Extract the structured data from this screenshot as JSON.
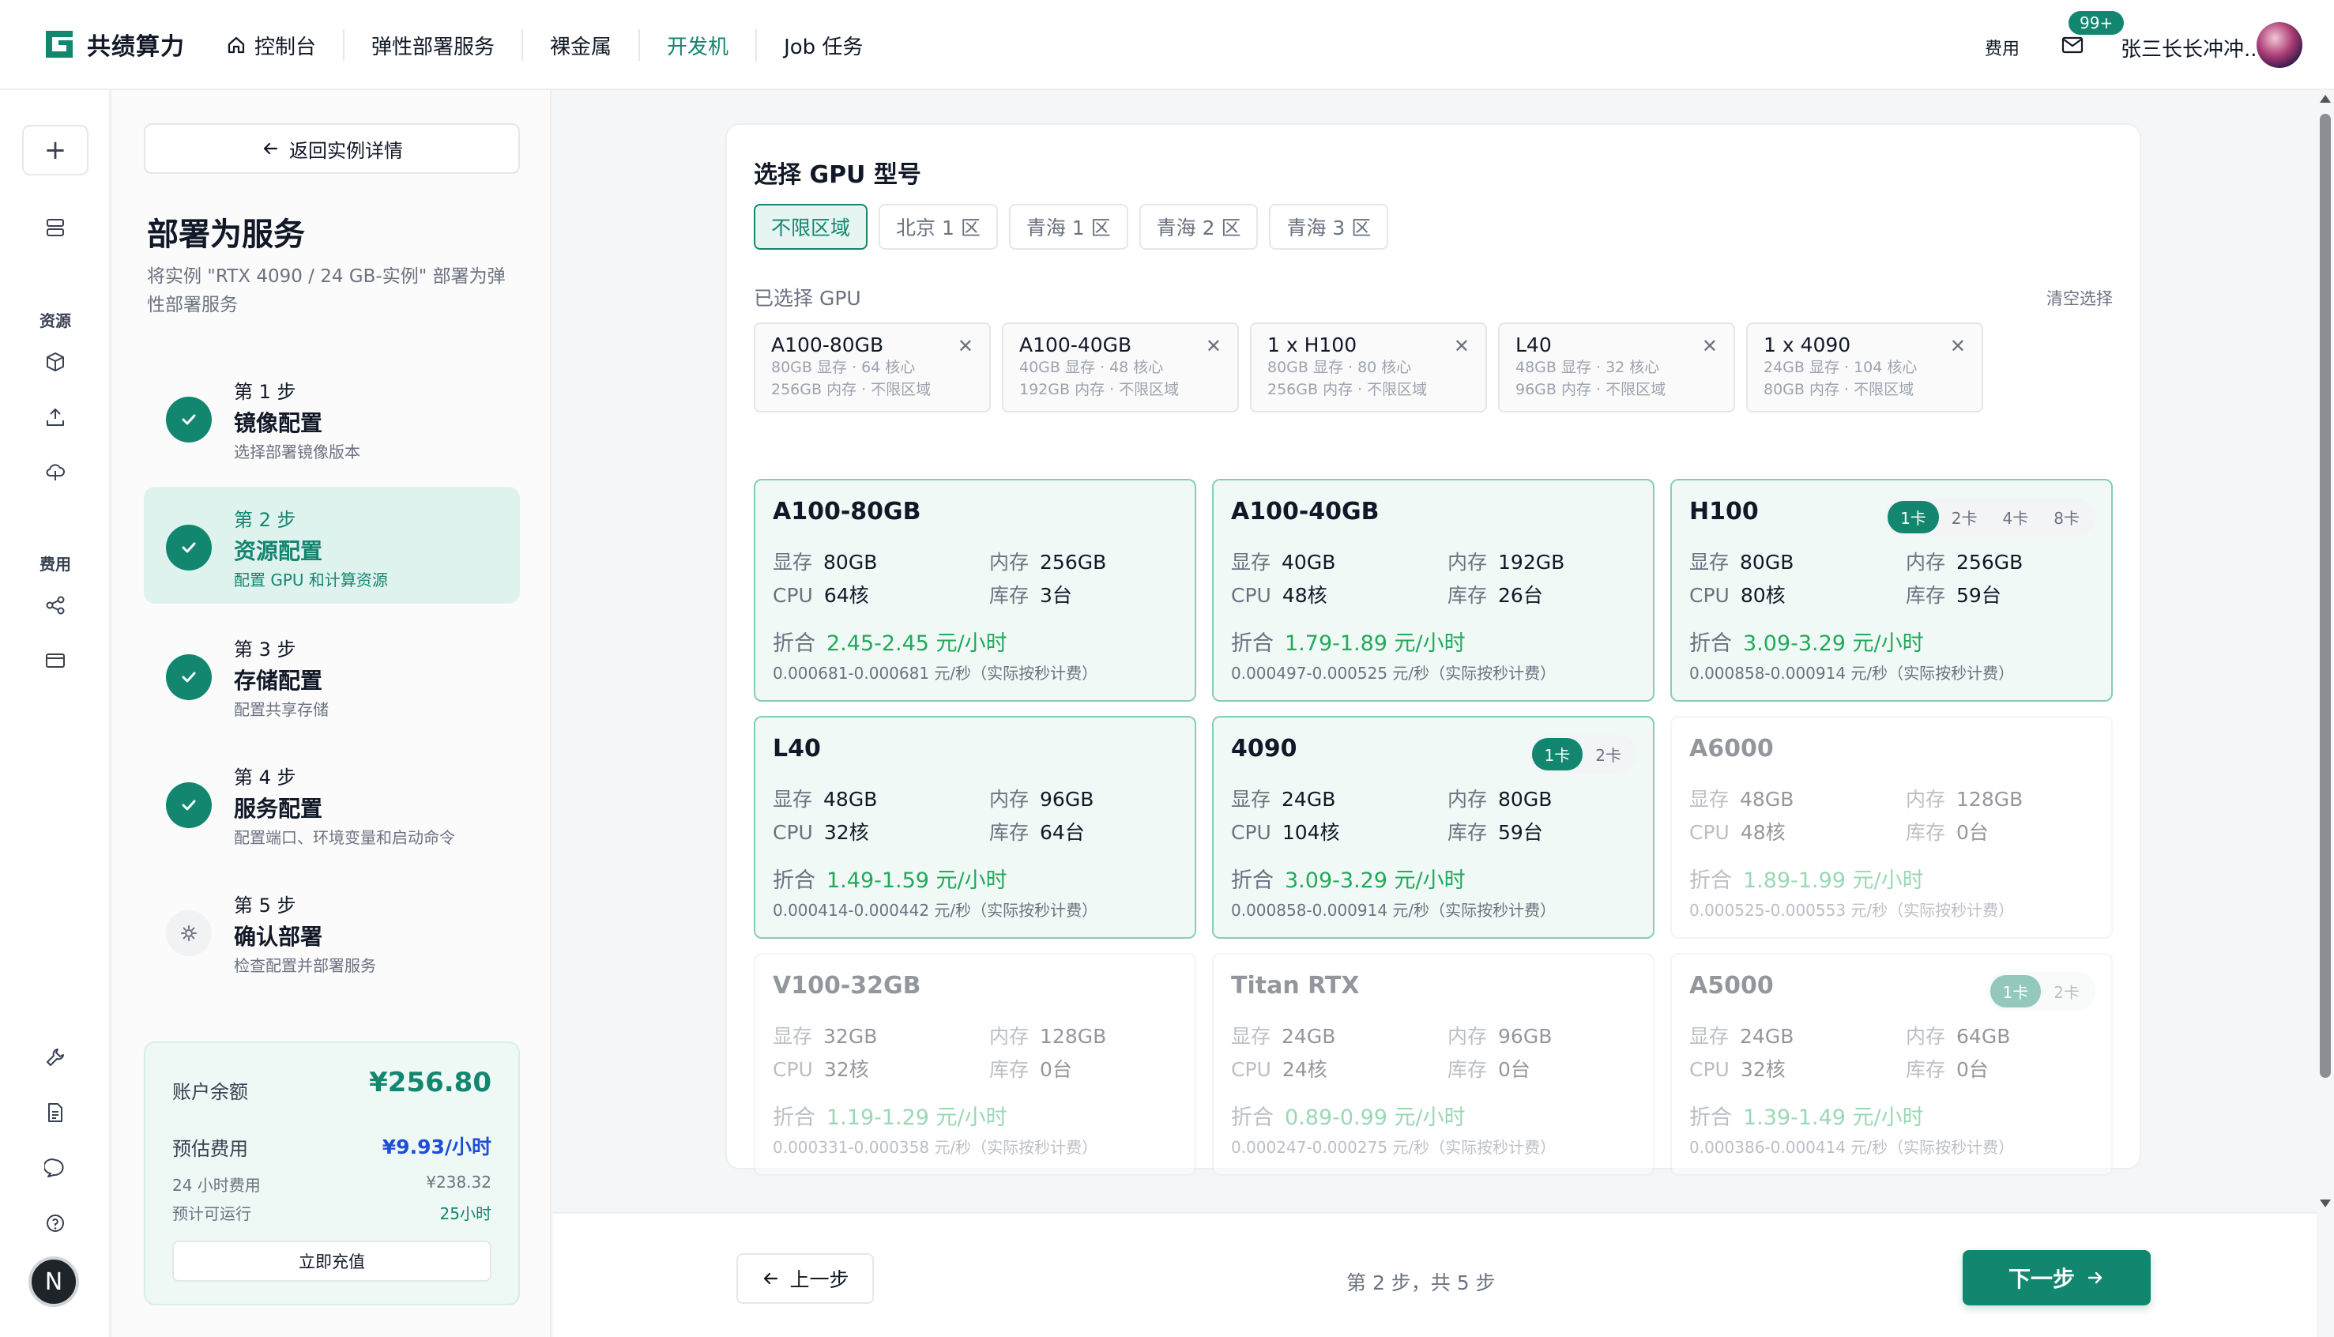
{
  "brand": {
    "name": "共绩算力",
    "accent": "#13866f"
  },
  "nav": [
    {
      "label": "控制台",
      "icon": "home-icon"
    },
    {
      "label": "弹性部署服务"
    },
    {
      "label": "裸金属"
    },
    {
      "label": "开发机",
      "active": true
    },
    {
      "label": "Job 任务"
    }
  ],
  "topright": {
    "fee": "费用",
    "badge": "99+",
    "username": "张三长长冲冲.."
  },
  "rail": {
    "section_resources": "资源",
    "section_fees": "费用",
    "user_initial": "N"
  },
  "steps_panel": {
    "back_label": "返回实例详情",
    "title": "部署为服务",
    "desc": "将实例 \"RTX 4090 / 24 GB-实例\" 部署为弹性部署服务",
    "steps": [
      {
        "num": "第 1 步",
        "name": "镜像配置",
        "sub": "选择部署镜像版本",
        "state": "done"
      },
      {
        "num": "第 2 步",
        "name": "资源配置",
        "sub": "配置 GPU 和计算资源",
        "state": "active"
      },
      {
        "num": "第 3 步",
        "name": "存储配置",
        "sub": "配置共享存储",
        "state": "done"
      },
      {
        "num": "第 4 步",
        "name": "服务配置",
        "sub": "配置端口、环境变量和启动命令",
        "state": "done"
      },
      {
        "num": "第 5 步",
        "name": "确认部署",
        "sub": "检查配置并部署服务",
        "state": "pending"
      }
    ],
    "balance": {
      "label": "账户余额",
      "value": "¥256.80",
      "est_label": "预估费用",
      "est_value": "¥9.93/小时",
      "day_label": "24 小时费用",
      "day_value": "¥238.32",
      "run_label": "预计可运行",
      "run_value": "25小时",
      "recharge": "立即充值"
    }
  },
  "gpu_select": {
    "title": "选择 GPU 型号",
    "regions": [
      "不限区域",
      "北京 1 区",
      "青海 1 区",
      "青海 2 区",
      "青海 3 区"
    ],
    "active_region": 0,
    "selected_label": "已选择 GPU",
    "clear_label": "清空选择",
    "chips": [
      {
        "name": "A100-80GB",
        "l1": "80GB 显存 · 64 核心",
        "l2": "256GB 内存 · 不限区域"
      },
      {
        "name": "A100-40GB",
        "l1": "40GB 显存 · 48 核心",
        "l2": "192GB 内存 · 不限区域"
      },
      {
        "name": "1 x H100",
        "l1": "80GB 显存 · 80 核心",
        "l2": "256GB 内存 · 不限区域"
      },
      {
        "name": "L40",
        "l1": "48GB 显存 · 32 核心",
        "l2": "96GB 内存 · 不限区域"
      },
      {
        "name": "1 x 4090",
        "l1": "24GB 显存 · 104 核心",
        "l2": "80GB 内存 · 不限区域"
      }
    ],
    "labels": {
      "vram": "显存",
      "mem": "内存",
      "cpu": "CPU",
      "stock": "库存",
      "price": "折合"
    },
    "cards": [
      {
        "name": "A100-80GB",
        "vram": "80GB",
        "mem": "256GB",
        "cpu": "64核",
        "stock": "3台",
        "price": "2.45-2.45 元/小时",
        "per_sec": "0.000681-0.000681 元/秒（实际按秒计费）",
        "state": "selected",
        "toggles": []
      },
      {
        "name": "A100-40GB",
        "vram": "40GB",
        "mem": "192GB",
        "cpu": "48核",
        "stock": "26台",
        "price": "1.79-1.89 元/小时",
        "per_sec": "0.000497-0.000525 元/秒（实际按秒计费）",
        "state": "selected",
        "toggles": []
      },
      {
        "name": "H100",
        "vram": "80GB",
        "mem": "256GB",
        "cpu": "80核",
        "stock": "59台",
        "price": "3.09-3.29 元/小时",
        "per_sec": "0.000858-0.000914 元/秒（实际按秒计费）",
        "state": "selected",
        "toggles": [
          "1卡",
          "2卡",
          "4卡",
          "8卡"
        ]
      },
      {
        "name": "L40",
        "vram": "48GB",
        "mem": "96GB",
        "cpu": "32核",
        "stock": "64台",
        "price": "1.49-1.59 元/小时",
        "per_sec": "0.000414-0.000442 元/秒（实际按秒计费）",
        "state": "selected",
        "toggles": []
      },
      {
        "name": "4090",
        "vram": "24GB",
        "mem": "80GB",
        "cpu": "104核",
        "stock": "59台",
        "price": "3.09-3.29 元/小时",
        "per_sec": "0.000858-0.000914 元/秒（实际按秒计费）",
        "state": "selected",
        "toggles": [
          "1卡",
          "2卡"
        ]
      },
      {
        "name": "A6000",
        "vram": "48GB",
        "mem": "128GB",
        "cpu": "48核",
        "stock": "0台",
        "price": "1.89-1.99 元/小时",
        "per_sec": "0.000525-0.000553 元/秒（实际按秒计费）",
        "state": "disabled",
        "toggles": []
      },
      {
        "name": "V100-32GB",
        "vram": "32GB",
        "mem": "128GB",
        "cpu": "32核",
        "stock": "0台",
        "price": "1.19-1.29 元/小时",
        "per_sec": "0.000331-0.000358 元/秒（实际按秒计费）",
        "state": "disabled",
        "toggles": []
      },
      {
        "name": "Titan RTX",
        "vram": "24GB",
        "mem": "96GB",
        "cpu": "24核",
        "stock": "0台",
        "price": "0.89-0.99 元/小时",
        "per_sec": "0.000247-0.000275 元/秒（实际按秒计费）",
        "state": "disabled",
        "toggles": []
      },
      {
        "name": "A5000",
        "vram": "24GB",
        "mem": "64GB",
        "cpu": "32核",
        "stock": "0台",
        "price": "1.39-1.49 元/小时",
        "per_sec": "0.000386-0.000414 元/秒（实际按秒计费）",
        "state": "disabled",
        "toggles": [
          "1卡",
          "2卡"
        ]
      }
    ]
  },
  "footer": {
    "prev": "上一步",
    "progress": "第 2 步，共 5 步",
    "next": "下一步"
  }
}
